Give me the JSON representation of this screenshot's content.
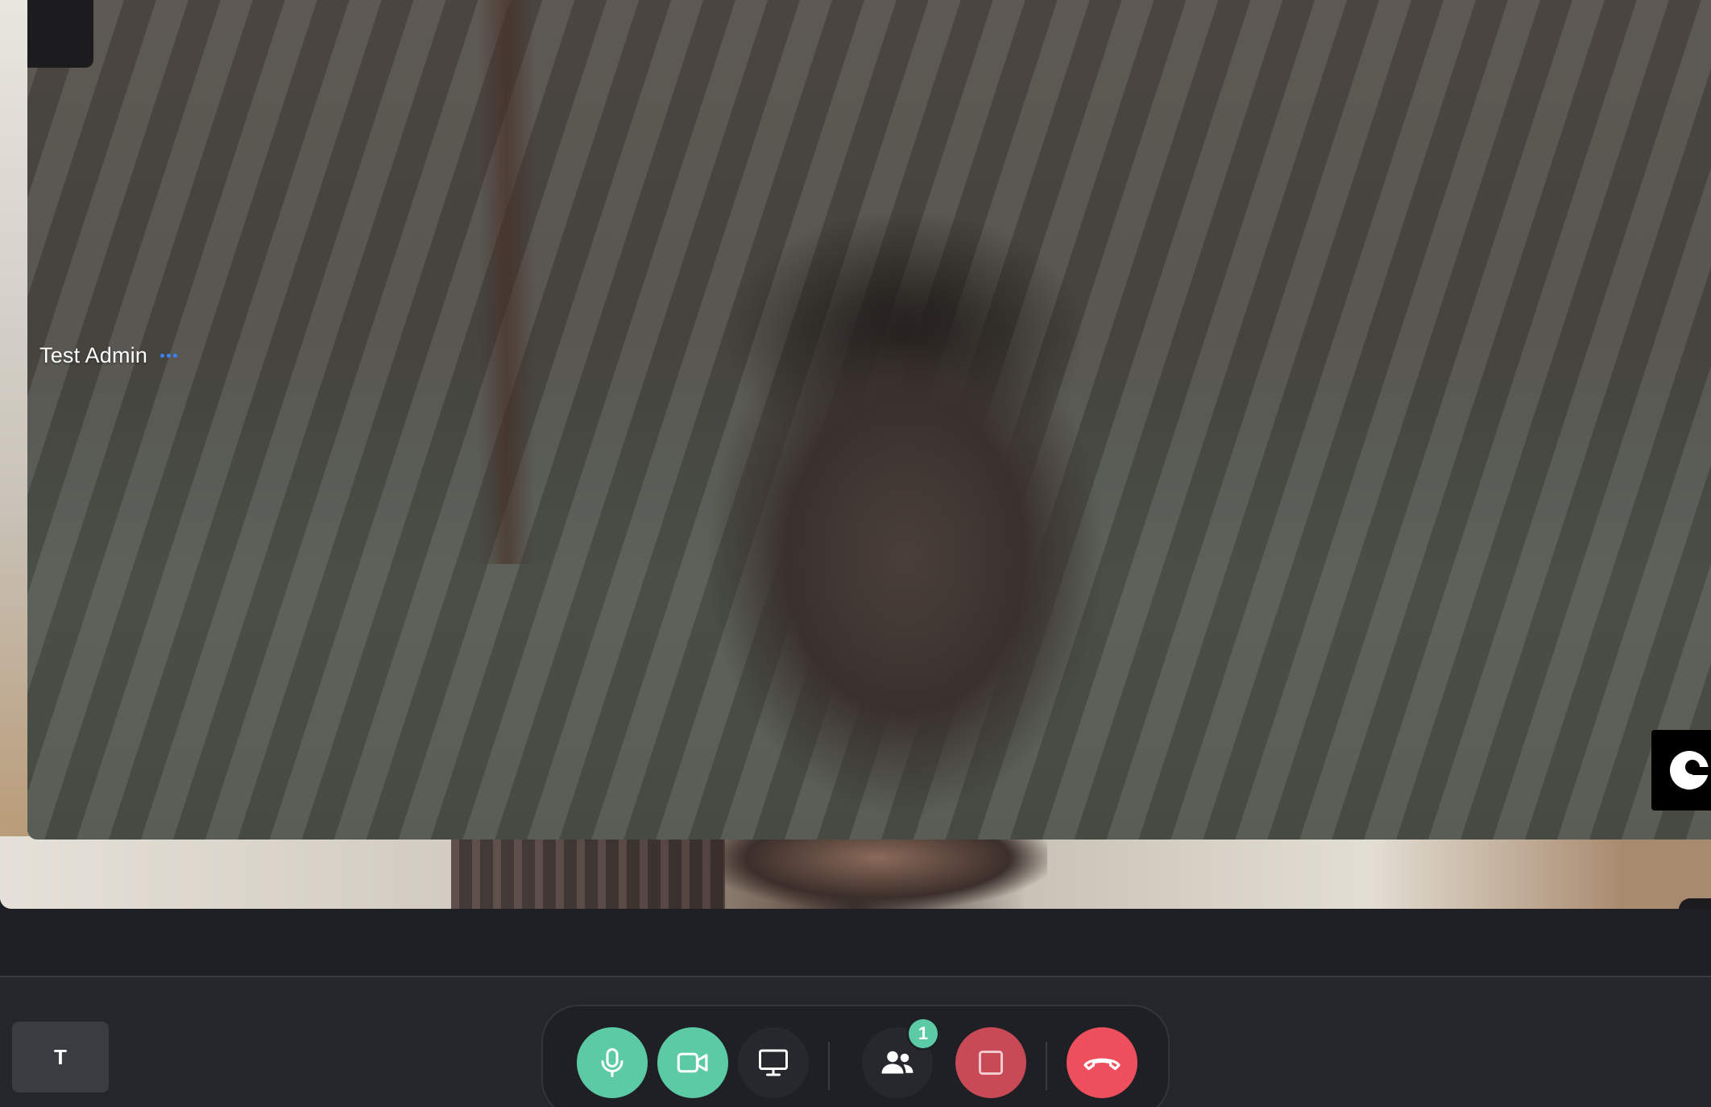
{
  "participant": {
    "name": "Test Admin",
    "more_icon": "more-horizontal-icon"
  },
  "chat_widget": {
    "icon": "chat-bubble-icon"
  },
  "local_user": {
    "initial": "T"
  },
  "controls": {
    "mic": {
      "icon": "microphone-icon",
      "state": "on",
      "color": "#5ccaa4"
    },
    "camera": {
      "icon": "video-camera-icon",
      "state": "on",
      "color": "#5ccaa4"
    },
    "screen_share": {
      "icon": "monitor-icon",
      "state": "off"
    },
    "participants": {
      "icon": "users-icon",
      "count": "1"
    },
    "record": {
      "icon": "stop-square-icon",
      "color": "#c84a57"
    },
    "end_call": {
      "icon": "phone-hangup-icon",
      "color": "#ee4f5c"
    }
  },
  "colors": {
    "accent_green": "#5ccaa4",
    "danger_red": "#ee4f5c",
    "dots_blue": "#3b82f6",
    "bar_background": "#25262b"
  }
}
